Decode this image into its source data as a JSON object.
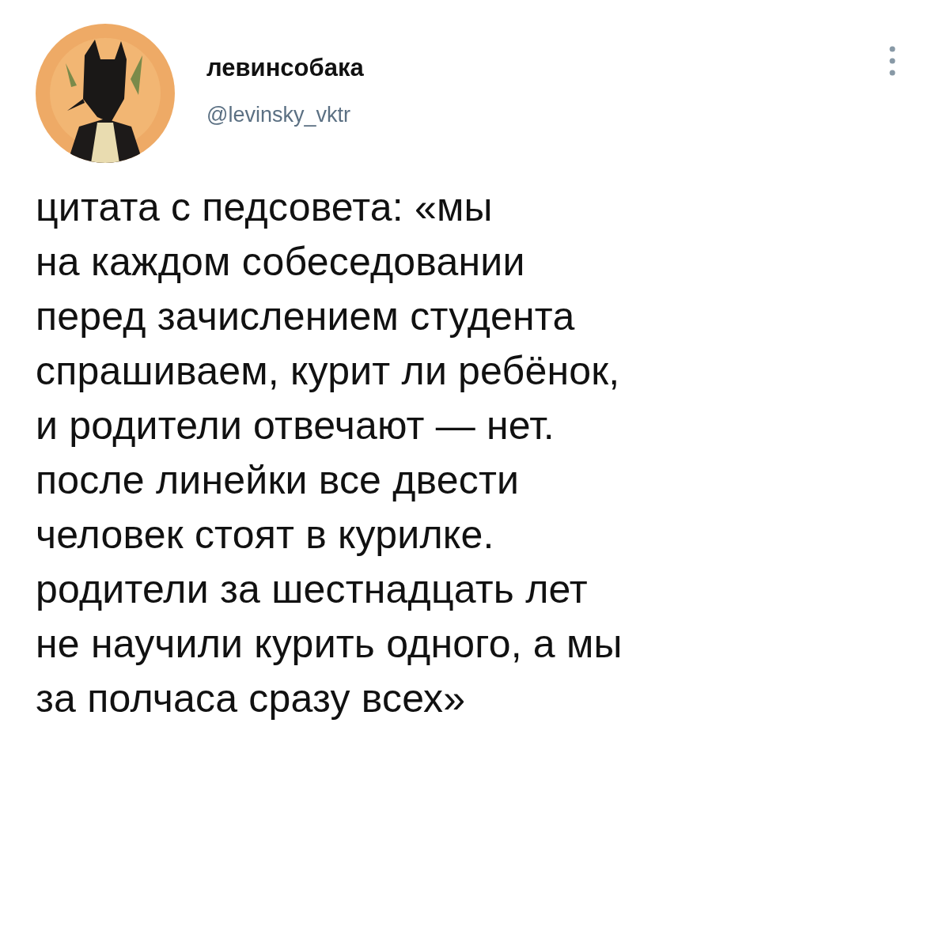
{
  "author": {
    "name": "левинсобака",
    "handle": "@levinsky_vktr"
  },
  "text": "цитата с педсовета: «мы\nна каждом собеседовании\nперед зачислением студента\nспрашиваем, курит ли ребёнок,\nи родители отвечают — нет.\nпосле линейки все двести\nчеловек стоят в курилке.\nродители за шестнадцать лет\nне научили курить одного, а мы\nза полчаса сразу всех»"
}
